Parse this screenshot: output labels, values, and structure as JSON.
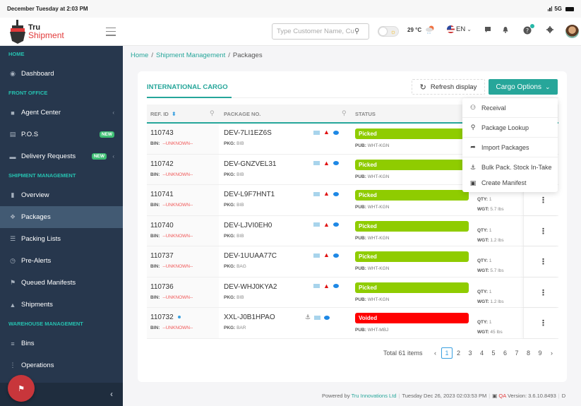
{
  "status_bar": {
    "datetime": "December Tuesday at 2:03 PM",
    "network": "5G"
  },
  "header": {
    "logo_line1": "Tru",
    "logo_line2": "Shipment",
    "search_placeholder": "Type Customer Name, Cu...",
    "temperature": "29 °C",
    "language": "EN",
    "icons": [
      "menu-icon",
      "search-icon",
      "theme-toggle",
      "weather-icon",
      "flag-us-icon",
      "chat-icon",
      "bell-icon",
      "help-icon",
      "gear-icon",
      "avatar"
    ]
  },
  "sidebar": {
    "sections": [
      {
        "title": "HOME",
        "items": [
          {
            "label": "Dashboard",
            "icon": "dashboard-icon"
          }
        ]
      },
      {
        "title": "FRONT OFFICE",
        "items": [
          {
            "label": "Agent Center",
            "icon": "agent-icon",
            "chevron": true
          },
          {
            "label": "P.O.S",
            "icon": "basket-icon",
            "badge": "NEW"
          },
          {
            "label": "Delivery Requests",
            "icon": "truck-icon",
            "badge": "NEW",
            "chevron": true
          }
        ]
      },
      {
        "title": "SHIPMENT MANAGEMENT",
        "items": [
          {
            "label": "Overview",
            "icon": "bookmark-icon"
          },
          {
            "label": "Packages",
            "icon": "dropbox-icon",
            "active": true
          },
          {
            "label": "Packing Lists",
            "icon": "list-icon"
          },
          {
            "label": "Pre-Alerts",
            "icon": "clock-icon"
          },
          {
            "label": "Queued Manifests",
            "icon": "flag-icon"
          },
          {
            "label": "Shipments",
            "icon": "ship-icon"
          }
        ]
      },
      {
        "title": "WAREHOUSE MANAGEMENT",
        "items": [
          {
            "label": "Bins",
            "icon": "bins-icon"
          },
          {
            "label": "Operations",
            "icon": "operations-icon"
          }
        ]
      }
    ]
  },
  "breadcrumb": {
    "home": "Home",
    "section": "Shipment Management",
    "current": "Packages",
    "separator": "/"
  },
  "card": {
    "tab": "INTERNATIONAL CARGO",
    "refresh_label": "Refresh display",
    "cargo_options_label": "Cargo Options",
    "columns": {
      "ref": "REF. ID",
      "package": "PACKAGE NO.",
      "status": "STATUS"
    },
    "labels": {
      "bin": "BIN:",
      "pkg": "PKG:",
      "pub": "PUB:",
      "qty": "QTY:",
      "wgt": "WGT:"
    },
    "rows": [
      {
        "ref": "110743",
        "bin": "--UNKNOWN--",
        "package_no": "DEV-7LI1EZ6S",
        "pkg": "BIB",
        "status": "Picked",
        "pub": "WHT-KGN",
        "qty": "1",
        "wgt": "",
        "anchor": false,
        "dot": false
      },
      {
        "ref": "110742",
        "bin": "--UNKNOWN--",
        "package_no": "DEV-GNZVEL31",
        "pkg": "BIB",
        "status": "Picked",
        "pub": "WHT-KGN",
        "qty": "1",
        "wgt": "",
        "anchor": false,
        "dot": false
      },
      {
        "ref": "110741",
        "bin": "--UNKNOWN--",
        "package_no": "DEV-L9F7HNT1",
        "pkg": "BIB",
        "status": "Picked",
        "pub": "WHT-KGN",
        "qty": "1",
        "wgt": "5.7 lbs",
        "anchor": false,
        "dot": false
      },
      {
        "ref": "110740",
        "bin": "--UNKNOWN--",
        "package_no": "DEV-LJVI0EH0",
        "pkg": "BIB",
        "status": "Picked",
        "pub": "WHT-KGN",
        "qty": "1",
        "wgt": "1.2 lbs",
        "anchor": false,
        "dot": false
      },
      {
        "ref": "110737",
        "bin": "--UNKNOWN--",
        "package_no": "DEV-1UUAA77C",
        "pkg": "BAG",
        "status": "Picked",
        "pub": "WHT-KGN",
        "qty": "1",
        "wgt": "5.7 lbs",
        "anchor": false,
        "dot": false
      },
      {
        "ref": "110736",
        "bin": "--UNKNOWN--",
        "package_no": "DEV-WHJ0KYA2",
        "pkg": "BIB",
        "status": "Picked",
        "pub": "WHT-KGN",
        "qty": "1",
        "wgt": "1.2 lbs",
        "anchor": false,
        "dot": false
      },
      {
        "ref": "110732",
        "bin": "--UNKNOWN--",
        "package_no": "XXL-J0B1HPAO",
        "pkg": "BAR",
        "status": "Voided",
        "pub": "WHT-MBJ",
        "qty": "1",
        "wgt": "45 lbs",
        "anchor": true,
        "dot": true
      }
    ],
    "status_colors": {
      "Picked": "#8fcc00",
      "Voided": "#ff0000"
    }
  },
  "dropdown": {
    "items": [
      {
        "label": "Receival",
        "icon": "people-icon"
      },
      {
        "label": "Package Lookup",
        "icon": "search-icon"
      },
      {
        "label": "Import Packages",
        "icon": "import-icon"
      },
      {
        "label": "Bulk Pack. Stock In-Take",
        "icon": "anchor-icon"
      },
      {
        "label": "Create Manifest",
        "icon": "scroll-icon"
      }
    ]
  },
  "pagination": {
    "total": "Total 61 items",
    "pages": [
      "1",
      "2",
      "3",
      "4",
      "5",
      "6",
      "7",
      "8",
      "9"
    ],
    "current": "1"
  },
  "footer": {
    "powered_by": "Powered by",
    "company": "Tru Innovations Ltd",
    "datetime": "Tuesday Dec 26, 2023 02:03:53 PM",
    "env": "QA",
    "version": "Version: 3.6.10.8493",
    "trailing": "D"
  },
  "colors": {
    "accent": "#26a69a",
    "sidebar_bg": "#27374d",
    "fab": "#c8363b"
  }
}
